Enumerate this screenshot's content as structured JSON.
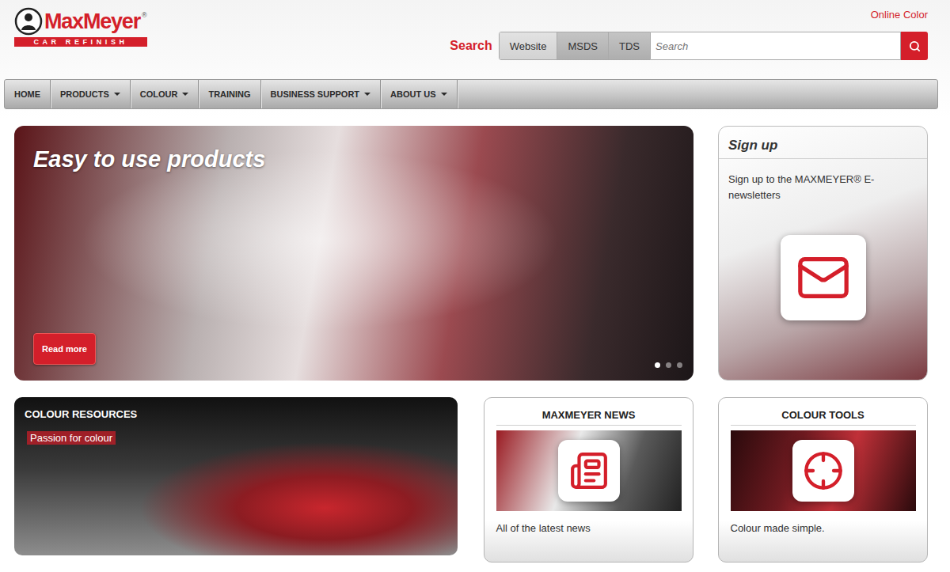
{
  "logo": {
    "name": "MaxMeyer",
    "mark": "®",
    "tagline": "CAR REFINISH"
  },
  "header_link": "Online Color",
  "search": {
    "label": "Search",
    "scopes": [
      {
        "label": "Website",
        "selected": true
      },
      {
        "label": "MSDS",
        "selected": false
      },
      {
        "label": "TDS",
        "selected": false
      }
    ],
    "placeholder": "Search"
  },
  "nav": [
    {
      "label": "HOME",
      "dropdown": false
    },
    {
      "label": "PRODUCTS",
      "dropdown": true
    },
    {
      "label": "COLOUR",
      "dropdown": true
    },
    {
      "label": "TRAINING",
      "dropdown": false
    },
    {
      "label": "BUSINESS SUPPORT",
      "dropdown": true
    },
    {
      "label": "ABOUT US",
      "dropdown": true
    }
  ],
  "hero": {
    "title": "Easy to use products",
    "button": "Read more",
    "slides": [
      {
        "selected": true
      },
      {
        "selected": false
      },
      {
        "selected": false
      }
    ]
  },
  "signup": {
    "title": "Sign up",
    "text": "Sign up to the MAXMEYER® E-newsletters"
  },
  "colour_resources": {
    "title": "COLOUR RESOURCES",
    "tag": "Passion for colour"
  },
  "cards": [
    {
      "title": "MAXMEYER NEWS",
      "caption": "All of the latest news",
      "kind": "news"
    },
    {
      "title": "COLOUR TOOLS",
      "caption": "Colour made simple.",
      "kind": "tools"
    }
  ]
}
